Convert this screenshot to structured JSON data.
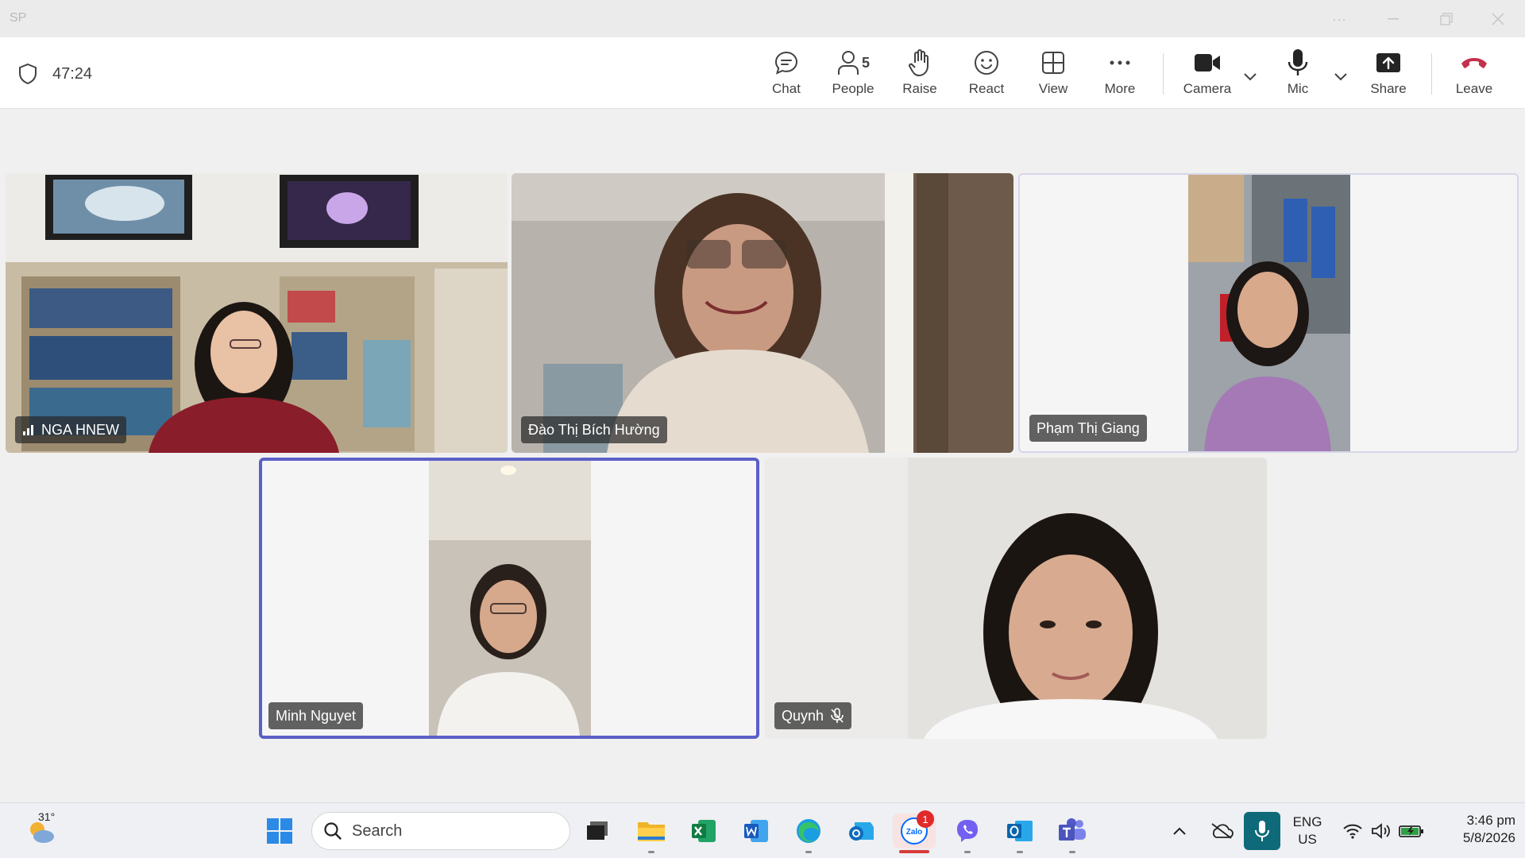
{
  "window": {
    "title": "SP"
  },
  "toolbar": {
    "timer": "47:24",
    "buttons": {
      "chat": "Chat",
      "people": "People",
      "people_count": "5",
      "raise": "Raise",
      "react": "React",
      "view": "View",
      "more": "More",
      "camera": "Camera",
      "mic": "Mic",
      "share": "Share",
      "leave": "Leave"
    },
    "colors": {
      "leave": "#c4314b",
      "accent": "#5b5fc7"
    }
  },
  "participants": [
    {
      "name": "NGA HNEW",
      "signal_icon": true
    },
    {
      "name": "Đào Thị Bích Hường"
    },
    {
      "name": "Phạm Thị Giang"
    },
    {
      "name": "Minh Nguyet",
      "active_speaker": true
    },
    {
      "name": "Quynh",
      "muted": true
    }
  ],
  "taskbar": {
    "weather": {
      "temp": "31°"
    },
    "search_placeholder": "Search",
    "zalo_badge": "1",
    "apps": [
      "start-icon",
      "task-view-icon",
      "file-explorer-icon",
      "excel-icon",
      "word-icon",
      "edge-icon",
      "outlook-new-icon",
      "zalo-icon",
      "viber-icon",
      "outlook-icon",
      "teams-icon"
    ],
    "tray": {
      "lang_line1": "ENG",
      "lang_line2": "US",
      "time": "3:46 pm",
      "date": "5/8/2026"
    }
  }
}
